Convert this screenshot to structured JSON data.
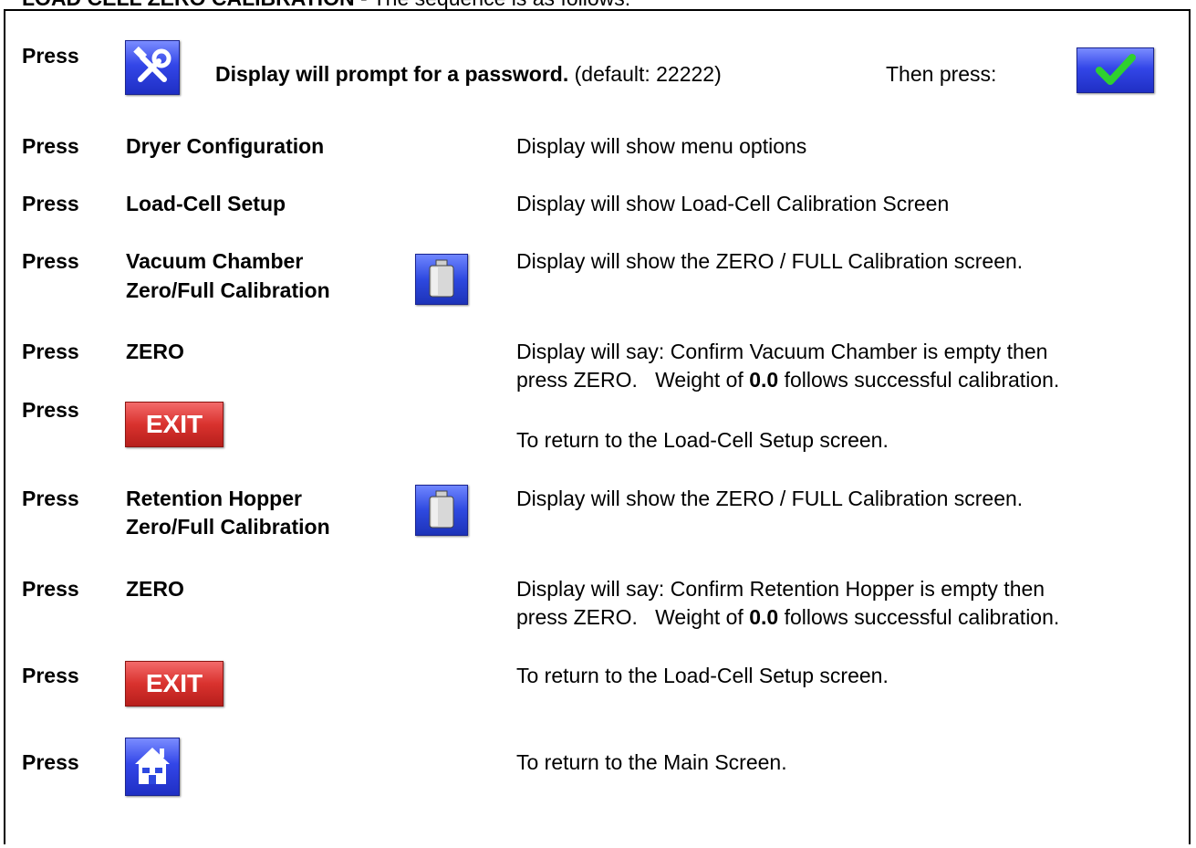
{
  "header": {
    "title": "LOAD CELL ZERO CALIBRATION",
    "subtitle": " - The sequence is as follows:"
  },
  "row1": {
    "press": "Press",
    "prompt_bold": "Display will prompt for a password.",
    "prompt_default": "(default: 22222)",
    "then_press": "Then press:",
    "tools_icon": "tools-icon",
    "check_icon": "checkmark-icon"
  },
  "row2": {
    "press": "Press",
    "action": "Dryer Configuration",
    "result": "Display will show menu options"
  },
  "row3": {
    "press": "Press",
    "action": "Load-Cell Setup",
    "result": "Display will show Load-Cell Calibration Screen"
  },
  "row4": {
    "press": "Press",
    "action_line1": "Vacuum Chamber",
    "action_line2": "Zero/Full Calibration",
    "result": "Display will show the ZERO / FULL Calibration screen.",
    "icon": "weight-icon"
  },
  "row5": {
    "press": "Press",
    "action": "ZERO",
    "result_line1": "Display will say: Confirm Vacuum Chamber is empty then",
    "result_line2_pre": "press ZERO.   Weight of ",
    "result_line2_bold": "0.0",
    "result_line2_post": " follows successful calibration."
  },
  "row6": {
    "press": "Press",
    "exit_label": "EXIT",
    "result": "To return to the Load-Cell Setup screen."
  },
  "row7": {
    "press": "Press",
    "action_line1": "Retention Hopper",
    "action_line2": "Zero/Full Calibration",
    "result": "Display will show the ZERO / FULL Calibration screen.",
    "icon": "weight-icon"
  },
  "row8": {
    "press": "Press",
    "action": "ZERO",
    "result_line1": "Display will say: Confirm Retention Hopper is empty then",
    "result_line2_pre": "press ZERO.   Weight of ",
    "result_line2_bold": "0.0",
    "result_line2_post": " follows successful calibration."
  },
  "row9": {
    "press": "Press",
    "exit_label": "EXIT",
    "result": "To return to the Load-Cell Setup screen."
  },
  "row10": {
    "press": "Press",
    "result": "To return to the Main Screen.",
    "icon": "home-icon"
  },
  "colors": {
    "blue_button": "#2e49e0",
    "exit_red": "#d9322e",
    "check_green": "#22c022"
  }
}
